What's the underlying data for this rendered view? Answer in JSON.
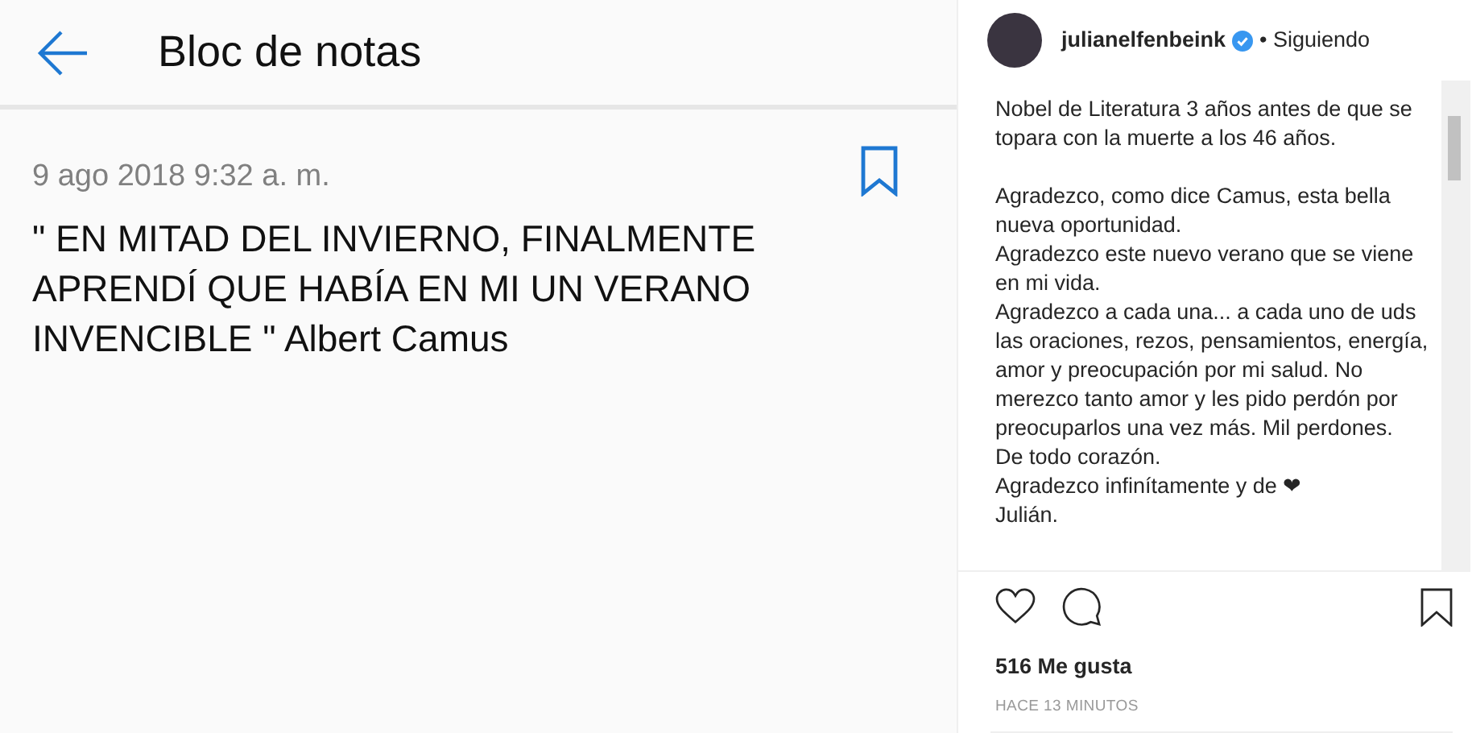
{
  "note_app": {
    "title": "Bloc de notas",
    "date": "9 ago 2018 9:32 a. m.",
    "lines": [
      "\" EN MITAD DEL INVIERNO, FINALMENTE",
      "APRENDÍ QUE HABÍA EN MI UN VERANO",
      "INVENCIBLE \" Albert Camus"
    ]
  },
  "post": {
    "username": "julianelfenbeink",
    "verified": true,
    "follow_state": "• Siguiendo",
    "caption_blocks": [
      [
        "Nobel de Literatura 3 años antes de que se",
        "topara con la muerte a los 46 años."
      ],
      [
        "Agradezco, como dice Camus, esta bella",
        "nueva oportunidad.",
        "Agradezco este nuevo verano que se viene",
        "en mi vida.",
        "Agradezco a cada una... a cada uno de uds",
        "las oraciones, rezos, pensamientos, energía,",
        "amor y preocupación por mi salud. No",
        "merezco tanto amor y les pido perdón por",
        "preocuparlos una vez más. Mil perdones.",
        "De todo corazón.",
        "Agradezco infinítamente y de ❤",
        "Julián."
      ]
    ],
    "likes": "516 Me gusta",
    "time": "HACE 13 MINUTOS"
  }
}
